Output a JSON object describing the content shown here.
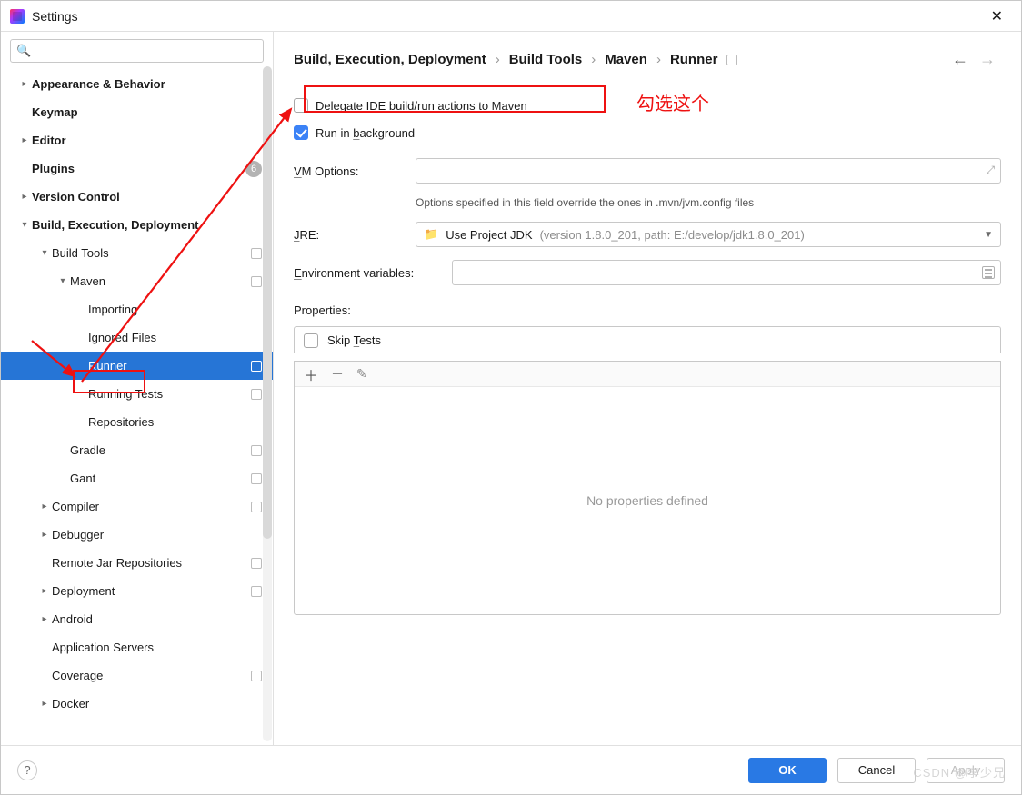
{
  "window": {
    "title": "Settings"
  },
  "search": {
    "placeholder": ""
  },
  "sidebar": {
    "items": [
      {
        "label": "Appearance & Behavior",
        "chev": ">",
        "bold": true,
        "lvl": 0
      },
      {
        "label": "Keymap",
        "chev": "",
        "bold": true,
        "lvl": 0
      },
      {
        "label": "Editor",
        "chev": ">",
        "bold": true,
        "lvl": 0
      },
      {
        "label": "Plugins",
        "chev": "",
        "bold": true,
        "lvl": 0,
        "badge": "6"
      },
      {
        "label": "Version Control",
        "chev": ">",
        "bold": true,
        "lvl": 0
      },
      {
        "label": "Build, Execution, Deployment",
        "chev": "v",
        "bold": true,
        "lvl": 0
      },
      {
        "label": "Build Tools",
        "chev": "v",
        "bold": false,
        "lvl": 1,
        "sq": true
      },
      {
        "label": "Maven",
        "chev": "v",
        "bold": false,
        "lvl": 2,
        "sq": true
      },
      {
        "label": "Importing",
        "chev": "",
        "bold": false,
        "lvl": 3
      },
      {
        "label": "Ignored Files",
        "chev": "",
        "bold": false,
        "lvl": 3
      },
      {
        "label": "Runner",
        "chev": "",
        "bold": false,
        "lvl": 3,
        "sq": true,
        "selected": true
      },
      {
        "label": "Running Tests",
        "chev": "",
        "bold": false,
        "lvl": 3,
        "sq": true
      },
      {
        "label": "Repositories",
        "chev": "",
        "bold": false,
        "lvl": 3
      },
      {
        "label": "Gradle",
        "chev": "",
        "bold": false,
        "lvl": 2,
        "sq": true
      },
      {
        "label": "Gant",
        "chev": "",
        "bold": false,
        "lvl": 2,
        "sq": true
      },
      {
        "label": "Compiler",
        "chev": ">",
        "bold": false,
        "lvl": 1,
        "sq": true
      },
      {
        "label": "Debugger",
        "chev": ">",
        "bold": false,
        "lvl": 1
      },
      {
        "label": "Remote Jar Repositories",
        "chev": "",
        "bold": false,
        "lvl": 1,
        "sq": true
      },
      {
        "label": "Deployment",
        "chev": ">",
        "bold": false,
        "lvl": 1,
        "sq": true
      },
      {
        "label": "Android",
        "chev": ">",
        "bold": false,
        "lvl": 1
      },
      {
        "label": "Application Servers",
        "chev": "",
        "bold": false,
        "lvl": 1
      },
      {
        "label": "Coverage",
        "chev": "",
        "bold": false,
        "lvl": 1,
        "sq": true
      },
      {
        "label": "Docker",
        "chev": ">",
        "bold": false,
        "lvl": 1
      }
    ]
  },
  "breadcrumbs": [
    "Build, Execution, Deployment",
    "Build Tools",
    "Maven",
    "Runner"
  ],
  "form": {
    "delegate_label": "Delegate IDE build/run actions to Maven",
    "delegate_checked": false,
    "background_label": "Run in background",
    "background_checked": true,
    "vm_label": "VM Options:",
    "vm_value": "",
    "vm_hint": "Options specified in this field override the ones in .mvn/jvm.config files",
    "jre_label": "JRE:",
    "jre_value": "Use Project JDK",
    "jre_detail": "(version 1.8.0_201, path: E:/develop/jdk1.8.0_201)",
    "env_label": "Environment variables:",
    "env_value": "",
    "props_label": "Properties:",
    "skip_tests_label": "Skip Tests",
    "skip_tests_checked": false,
    "props_empty": "No properties defined"
  },
  "footer": {
    "ok": "OK",
    "cancel": "Cancel",
    "apply": "Apply"
  },
  "annotation": {
    "text": "勾选这个"
  },
  "watermark": "CSDN @李少兄"
}
